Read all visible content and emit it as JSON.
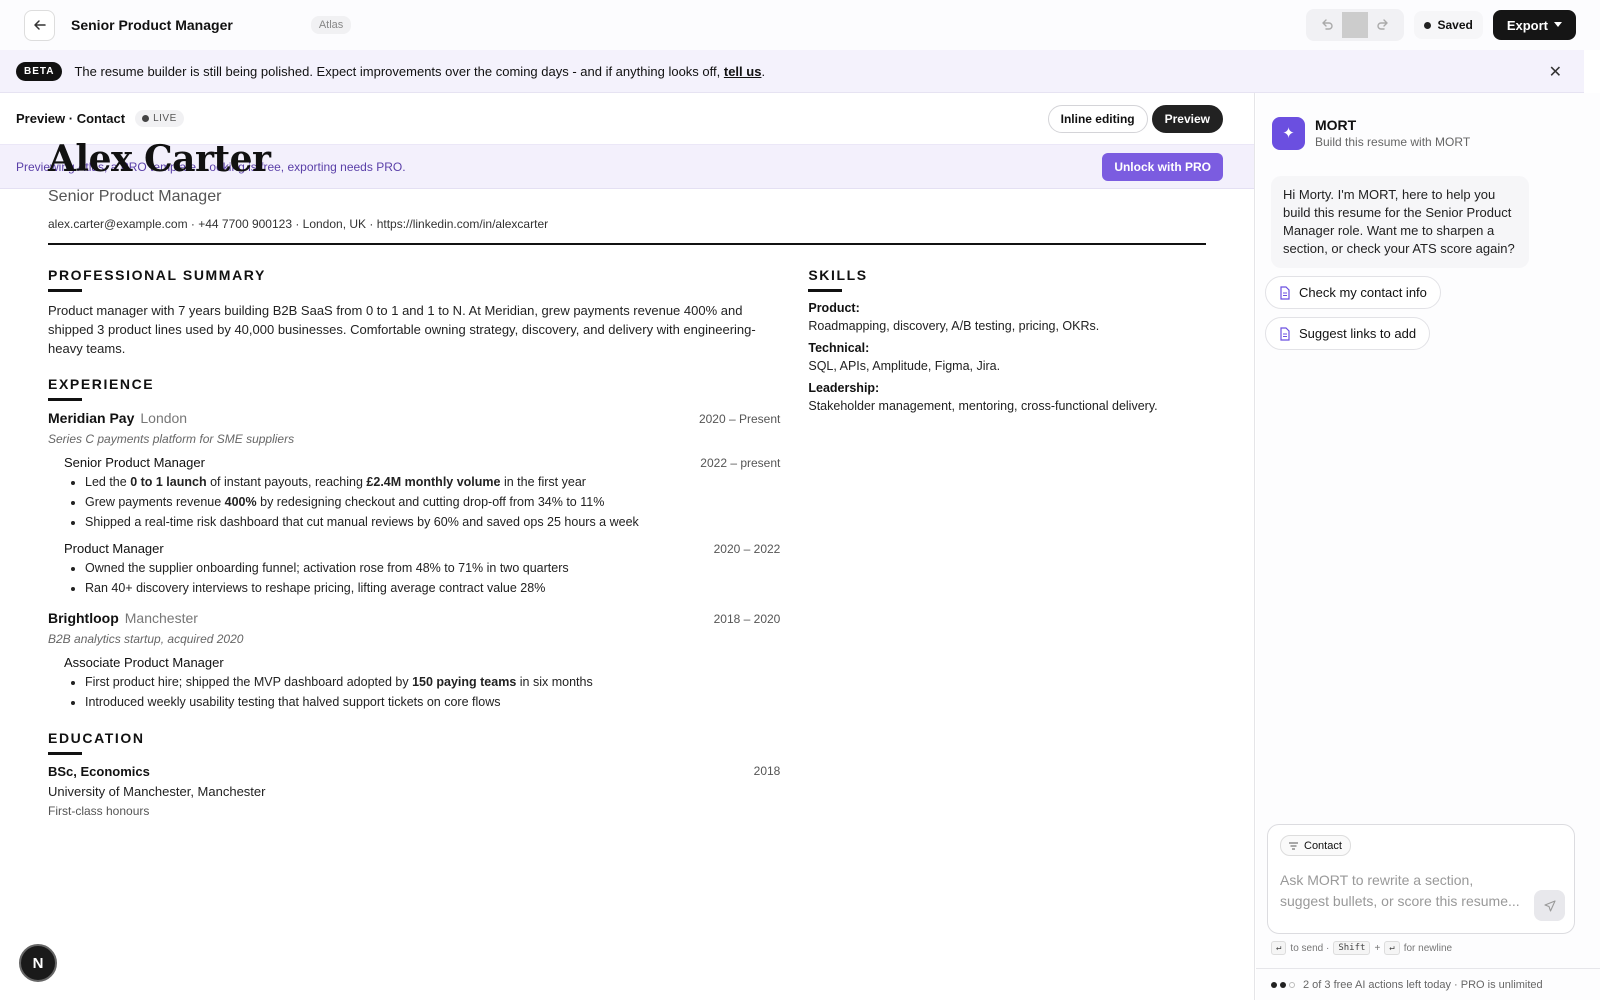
{
  "topbar": {
    "title": "Senior Product Manager",
    "template_tag": "Atlas",
    "saved_label": "Saved",
    "export_label": "Export"
  },
  "beta": {
    "badge": "BETA",
    "text": "The resume builder is still being polished. Expect improvements over the coming days - and if anything looks off,",
    "link": "tell us",
    "end": "."
  },
  "preview": {
    "title": "Preview · Contact",
    "live": "LIVE",
    "inline_editing": "Inline editing",
    "preview_btn": "Preview",
    "pro_notice": "Previewing Atlas, a PRO template. Looking is free, exporting needs PRO.",
    "pro_button": "Unlock with PRO"
  },
  "resume": {
    "name": "Alex Carter",
    "role": "Senior Product Manager",
    "contact": "alex.carter@example.com · +44 7700 900123 · London, UK · https://linkedin.com/in/alexcarter",
    "summary_heading": "PROFESSIONAL SUMMARY",
    "summary": "Product manager with 7 years building B2B SaaS from 0 to 1 and 1 to N. At Meridian, grew payments revenue 400% and shipped 3 product lines used by 40,000 businesses. Comfortable owning strategy, discovery, and delivery with engineering-heavy teams.",
    "experience_heading": "EXPERIENCE",
    "experience": [
      {
        "company": "Meridian Pay",
        "location": "London",
        "dates": "2020 – Present",
        "desc": "Series C payments platform for SME suppliers",
        "roles": [
          {
            "title": "Senior Product Manager",
            "dates": "2022 – present",
            "bullets": [
              [
                "Led the ",
                "0 to 1 launch",
                " of instant payouts, reaching ",
                "£2.4M monthly volume",
                " in the first year"
              ],
              [
                "Grew payments revenue ",
                "400%",
                " by redesigning checkout and cutting drop-off from 34% to 11%"
              ],
              [
                "Shipped a real-time risk dashboard that cut manual reviews by 60% and saved ops 25 hours a week"
              ]
            ]
          },
          {
            "title": "Product Manager",
            "dates": "2020 – 2022",
            "bullets": [
              [
                "Owned the supplier onboarding funnel; activation rose from 48% to 71% in two quarters"
              ],
              [
                "Ran 40+ discovery interviews to reshape pricing, lifting average contract value 28%"
              ]
            ]
          }
        ]
      },
      {
        "company": "Brightloop",
        "location": "Manchester",
        "dates": "2018 – 2020",
        "desc": "B2B analytics startup, acquired 2020",
        "roles": [
          {
            "title": "Associate Product Manager",
            "dates": "",
            "bullets": [
              [
                "First product hire; shipped the MVP dashboard adopted by ",
                "150 paying teams",
                " in six months"
              ],
              [
                "Introduced weekly usability testing that halved support tickets on core flows"
              ]
            ]
          }
        ]
      }
    ],
    "education_heading": "EDUCATION",
    "education": {
      "degree": "BSc, Economics",
      "year": "2018",
      "school": "University of Manchester, Manchester",
      "note": "First-class honours"
    },
    "skills_heading": "SKILLS",
    "skills": [
      {
        "label": "Product:",
        "value": "Roadmapping, discovery, A/B testing, pricing, OKRs."
      },
      {
        "label": "Technical:",
        "value": "SQL, APIs, Amplitude, Figma, Jira."
      },
      {
        "label": "Leadership:",
        "value": "Stakeholder management, mentoring, cross-functional delivery."
      }
    ]
  },
  "badge_letter": "N",
  "assistant": {
    "name": "MORT",
    "subtitle": "Build this resume with MORT",
    "message": "Hi Morty. I'm MORT, here to help you build this resume for the Senior Product Manager role. Want me to sharpen a section, or check your ATS score again?",
    "chips": [
      "Check my contact info",
      "Suggest links to add"
    ],
    "context_chip": "Contact",
    "input_placeholder": "Ask MORT to rewrite a section, suggest bullets, or score this resume...",
    "hint_send": "to send ·",
    "hint_shift": "Shift",
    "hint_plus": "+",
    "hint_newline": "for newline",
    "quota_text": "2 of 3 free AI actions left today · PRO is unlimited",
    "quota_used": 2,
    "quota_total": 3
  },
  "colors": {
    "accent": "#7b5ce0",
    "mort_icon": "#6b4fe0",
    "beta_bg": "#f4f2fc"
  }
}
